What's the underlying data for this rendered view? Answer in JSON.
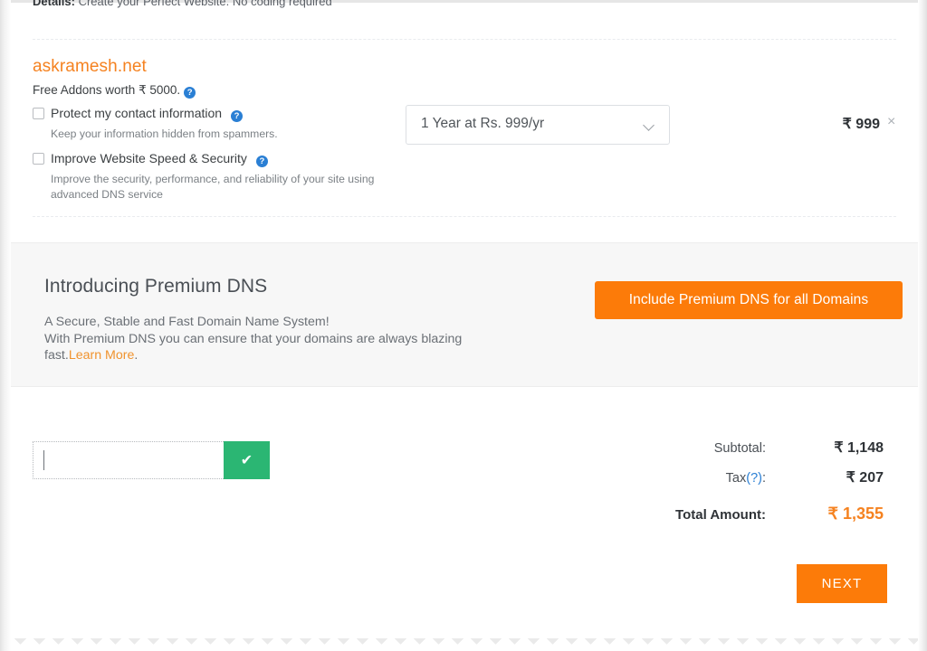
{
  "top_clipped_notice": {
    "label": "Details:",
    "text": " Create your Perfect Website. No coding required"
  },
  "cart_item": {
    "domain": "askramesh.net",
    "free_addons_text": "Free Addons worth ₹ 5000.",
    "free_addons_help_icon": "help-icon",
    "term_select": {
      "value": "1 Year at Rs. 999/yr",
      "chevron_icon": "chevron-down-icon"
    },
    "price": "₹ 999",
    "remove_icon": "×",
    "addons": [
      {
        "label": "Protect my contact information",
        "description": "Keep your information hidden from spammers.",
        "checked": false,
        "help_icon": "help-icon"
      },
      {
        "label": "Improve Website Speed & Security",
        "description": "Improve the security, performance, and reliability of your site using advanced DNS service",
        "checked": false,
        "help_icon": "help-icon"
      }
    ]
  },
  "premium_dns": {
    "title": "Introducing Premium DNS",
    "line1": "A Secure, Stable and Fast Domain Name System!",
    "line2": "With Premium DNS you can ensure that your domains are always blazing fast.",
    "link_label": "Learn More",
    "line_end": ".",
    "button_label": "Include Premium DNS for all Domains"
  },
  "coupon": {
    "value": "",
    "placeholder": "",
    "apply_icon": "✔"
  },
  "totals": [
    {
      "label": "Subtotal:",
      "amount": "₹ 1,148"
    },
    {
      "label": "Tax",
      "suffix": "(?)",
      "label_end": ":",
      "amount": "₹ 207"
    },
    {
      "label": "Total Amount:",
      "amount": "₹ 1,355"
    }
  ],
  "next_button": {
    "label": "NEXT"
  },
  "colors": {
    "brand_orange": "#f58220",
    "button_orange": "#fc7b09",
    "green": "#2bb673",
    "help_blue": "#2a7fd4",
    "band_gray": "#f7f7f7"
  }
}
